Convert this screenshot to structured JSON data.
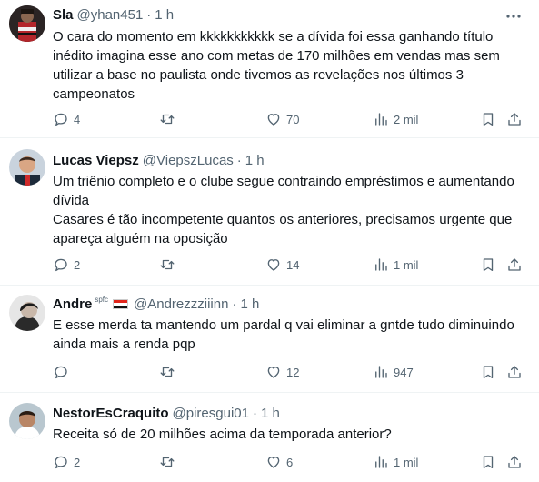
{
  "colors": {
    "text": "#0f1419",
    "secondary": "#536471",
    "divider": "#eff3f4"
  },
  "tweets": [
    {
      "name": "Sla",
      "badge": "",
      "handle": "@yhan451",
      "time": "1 h",
      "lines": [
        "O cara do momento em kkkkkkkkkkk se a dívida foi essa ganhando título",
        "inédito imagina esse ano com metas de 170 milhões em vendas mas sem",
        "utilizar a base no paulista onde tivemos as revelações nos últimos 3",
        "campeonatos"
      ],
      "replies": "4",
      "reposts": "",
      "likes": "70",
      "views": "2 mil"
    },
    {
      "name": "Lucas Viepsz",
      "badge": "",
      "handle": "@ViepszLucas",
      "time": "1 h",
      "lines": [
        "Um triênio completo e o clube segue contraindo empréstimos e aumentando",
        "dívida",
        "Casares é tão incompetente quantos os anteriores, precisamos urgente que",
        "apareça alguém na oposição"
      ],
      "replies": "2",
      "reposts": "",
      "likes": "14",
      "views": "1 mil"
    },
    {
      "name": "Andre",
      "badge": "spfc",
      "handle": "@Andrezzziiinn",
      "time": "1 h",
      "lines": [
        "E esse merda ta mantendo um pardal q vai eliminar a gntde tudo diminuindo",
        "ainda mais a renda pqp"
      ],
      "replies": "",
      "reposts": "",
      "likes": "12",
      "views": "947"
    },
    {
      "name": "NestorEsCraquito",
      "badge": "",
      "handle": "@piresgui01",
      "time": "1 h",
      "lines": [
        "Receita só de 20 milhões acima da temporada anterior?"
      ],
      "replies": "2",
      "reposts": "",
      "likes": "6",
      "views": "1 mil"
    }
  ]
}
